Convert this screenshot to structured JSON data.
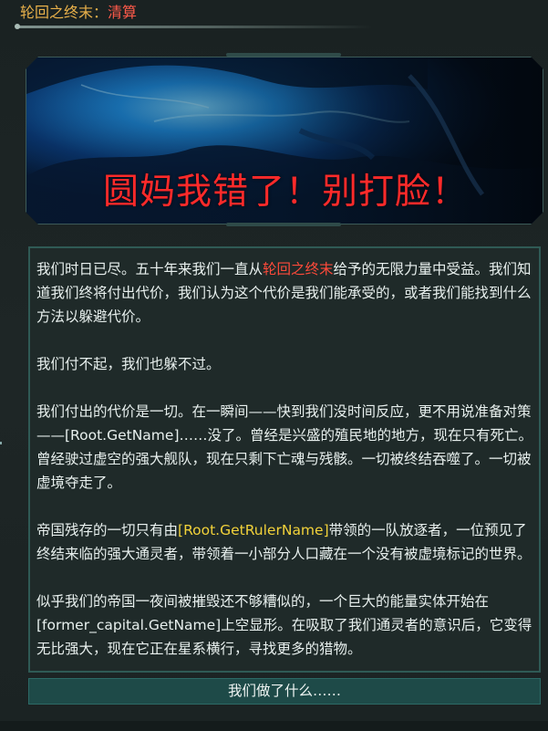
{
  "window": {
    "title": "轮回之终末",
    "title_sep": "：",
    "subtitle": "清算"
  },
  "image": {
    "caption": "圆妈我错了！别打脸！"
  },
  "body": {
    "p1_a": "我们时日已尽。五十年来我们一直从",
    "p1_hl": "轮回之终末",
    "p1_b": "给予的无限力量中受益。我们知道我们终将付出代价，我们认为这个代价是我们能承受的，或者我们能找到什么方法以躲避代价。",
    "p2": "我们付不起，我们也躲不过。",
    "p3": "我们付出的代价是一切。在一瞬间——快到我们没时间反应，更不用说准备对策——[Root.GetName]……没了。曾经是兴盛的殖民地的地方，现在只有死亡。曾经驶过虚空的强大舰队，现在只剩下亡魂与残骸。一切被终结吞噬了。一切被虚境夺走了。",
    "p4_a": "帝国残存的一切只有由",
    "p4_hl": "[Root.GetRulerName]",
    "p4_b": "带领的一队放逐者，一位预见了终结来临的强大通灵者，带领着一小部分人口藏在一个没有被虚境标记的世界。",
    "p5": "似乎我们的帝国一夜间被摧毁还不够糟似的，一个巨大的能量实体开始在[former_capital.GetName]上空显形。在吸取了我们通灵者的意识后，它变得无比强大，现在它正在星系横行，寻找更多的猎物。"
  },
  "actions": {
    "primary_label": "我们做了什么……"
  },
  "colors": {
    "title": "#e8b04a",
    "subtitle": "#ff5a4a",
    "highlight_red": "#ff4a3a",
    "highlight_yellow": "#f2d23a",
    "caption": "#ff2a2a",
    "button_bg": "#1e4a48"
  }
}
